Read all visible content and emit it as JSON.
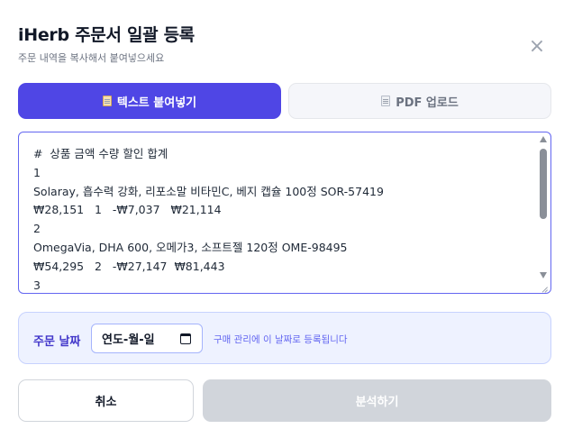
{
  "header": {
    "title": "iHerb 주문서 일괄 등록",
    "subtitle": "주문 내역을 복사해서 붙여넣으세요",
    "close_label": "×"
  },
  "tabs": [
    {
      "label": "텍스트 붙여넣기",
      "icon": "clipboard-icon",
      "active": true
    },
    {
      "label": "PDF 업로드",
      "icon": "document-icon",
      "active": false
    }
  ],
  "textarea": {
    "lines": [
      "#  상품 금액 수량 할인 합계",
      "1",
      "Solaray, 흡수력 강화, 리포소말 비타민C, 베지 캡슐 100정 SOR-57419",
      "₩28,151   1   -₩7,037   ₩21,114",
      "2",
      "OmegaVia, DHA 600, 오메가3, 소프트젤 120정 OME-98495",
      "₩54,295   2   -₩27,147  ₩81,443",
      "3"
    ]
  },
  "order_date": {
    "label": "주문 날짜",
    "placeholder": "연도-월-일",
    "hint": "구매 관리에 이 날짜로 등록됩니다"
  },
  "actions": {
    "cancel_label": "취소",
    "analyze_label": "분석하기"
  },
  "colors": {
    "accent": "#4f46e5",
    "disabled": "#d1d5db",
    "panel_bg": "#eef2ff"
  }
}
